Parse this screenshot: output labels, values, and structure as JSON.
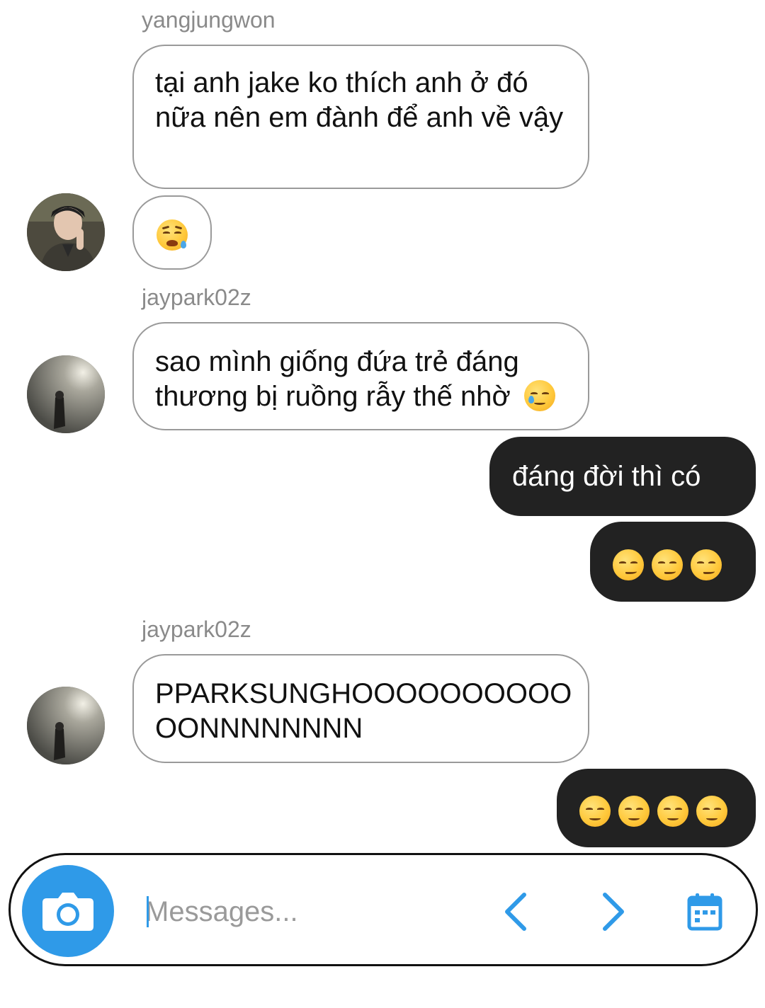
{
  "messages": [
    {
      "sender": "yangjungwon",
      "text": "tại anh jake ko thích anh ở đó nữa nên em đành để anh về vậy"
    },
    {
      "emoji": "sad-relieved-face"
    },
    {
      "sender": "jaypark02z",
      "text": "sao mình giống đứa trẻ đáng thương bị ruồng rẫy thế nhờ",
      "emoji": "smiling-face-with-tear"
    },
    {
      "outgoing_text": "đáng đời thì có",
      "outgoing_emojis": [
        "smirking-face",
        "smirking-face",
        "smirking-face"
      ]
    },
    {
      "sender": "jaypark02z",
      "text_lines": [
        "PPARKSUNGHOOOOOOOOOO",
        "OONNNNNNNN"
      ]
    },
    {
      "outgoing_emojis": [
        "relieved-face",
        "relieved-face",
        "relieved-face",
        "relieved-face"
      ]
    }
  ],
  "composer": {
    "placeholder": "Messages...",
    "icons": [
      "camera-icon",
      "chevron-left-icon",
      "chevron-right-icon",
      "calendar-icon"
    ],
    "accent_color": "#2f9ae8"
  },
  "colors": {
    "incoming_bubble": "#ffffff",
    "outgoing_bubble": "#222222",
    "sender_name": "#8a8a8a"
  }
}
